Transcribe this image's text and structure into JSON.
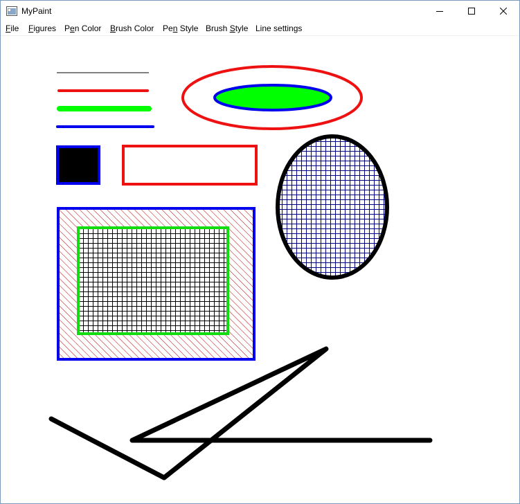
{
  "window": {
    "title": "MyPaint"
  },
  "menu": {
    "file": {
      "mn": "F",
      "rest": "ile"
    },
    "figures": {
      "mn": "F",
      "rest": "igures"
    },
    "pen_color": {
      "pre": "P",
      "mn": "e",
      "rest": "n Color"
    },
    "brush_color": {
      "mn": "B",
      "rest": "rush Color"
    },
    "pen_style": {
      "pre": "Pe",
      "mn": "n",
      "rest": " Style"
    },
    "brush_style": {
      "pre": "Brush ",
      "mn": "S",
      "rest": "tyle"
    },
    "line_settings": {
      "label": "Line settings"
    }
  },
  "icons": {
    "app": "paint-app-icon",
    "minimize": "minimize-icon",
    "maximize": "maximize-icon",
    "close": "close-icon"
  },
  "colors": {
    "red": "#ee1111",
    "green": "#00ff00",
    "blue": "#0000ee",
    "black": "#000000",
    "navy": "#000080",
    "stroke_green": "#11dd11"
  }
}
